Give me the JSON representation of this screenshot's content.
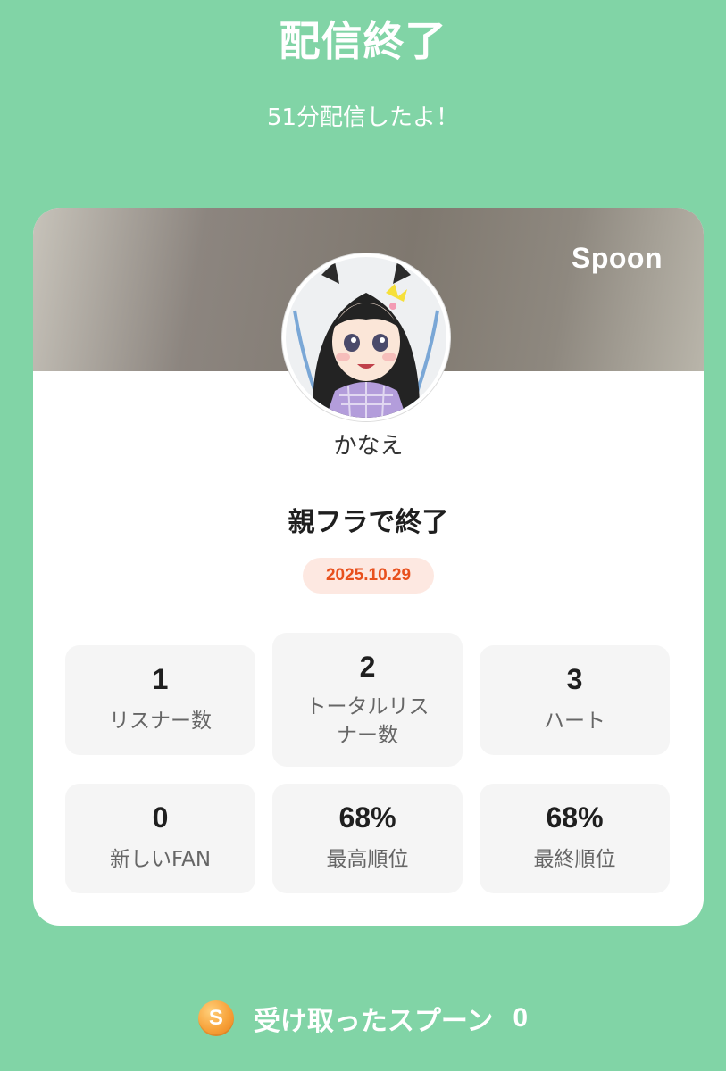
{
  "header": {
    "title": "配信終了",
    "subtitle": "51分配信したよ！"
  },
  "card": {
    "brand": "Spoon",
    "avatar_icon": "user-avatar",
    "username": "かなえ",
    "live_title": "親フラで終了",
    "date": "2025.10.29",
    "stats": [
      {
        "value": "1",
        "label": "リスナー数"
      },
      {
        "value": "2",
        "label": "トータルリスナー数"
      },
      {
        "value": "3",
        "label": "ハート"
      },
      {
        "value": "0",
        "label": "新しいFAN"
      },
      {
        "value": "68%",
        "label": "最高順位"
      },
      {
        "value": "68%",
        "label": "最終順位"
      }
    ]
  },
  "footer": {
    "coin_letter": "S",
    "label": "受け取ったスプーン",
    "count": "0"
  },
  "colors": {
    "background": "#81d4a6",
    "date_text": "#e8501d",
    "date_bg": "#fde8e1",
    "coin": "#f7a23a"
  }
}
